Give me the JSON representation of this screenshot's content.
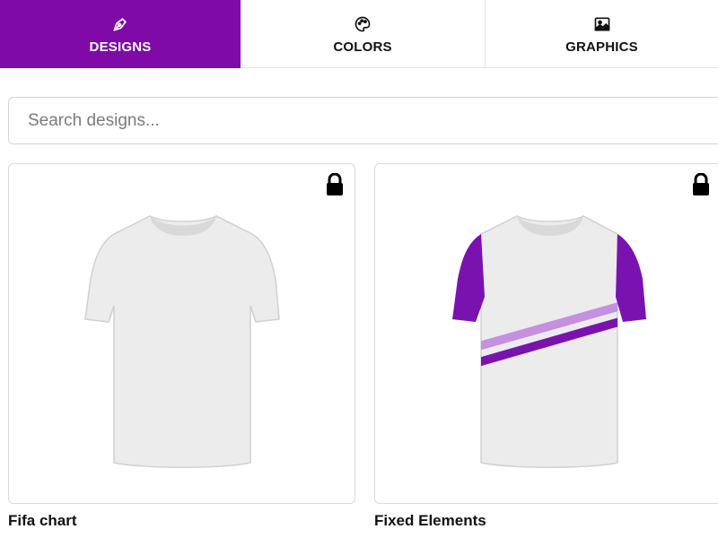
{
  "tabs": [
    {
      "label": "DESIGNS",
      "icon": "pen-nib-icon",
      "active": true
    },
    {
      "label": "COLORS",
      "icon": "palette-icon",
      "active": false
    },
    {
      "label": "GRAPHICS",
      "icon": "image-icon",
      "active": false
    }
  ],
  "search": {
    "placeholder": "Search designs..."
  },
  "designs": [
    {
      "title": "Fifa chart",
      "locked": true,
      "shirt": "plain-white-tshirt"
    },
    {
      "title": "Fixed Elements",
      "locked": true,
      "shirt": "white-tshirt-purple-sleeves-diagonal-stripes"
    }
  ],
  "colors": {
    "accent": "#7f0aa8",
    "stripe_light": "#c590e0",
    "stripe_dark": "#7a12b0",
    "shirt_white": "#ececec"
  }
}
